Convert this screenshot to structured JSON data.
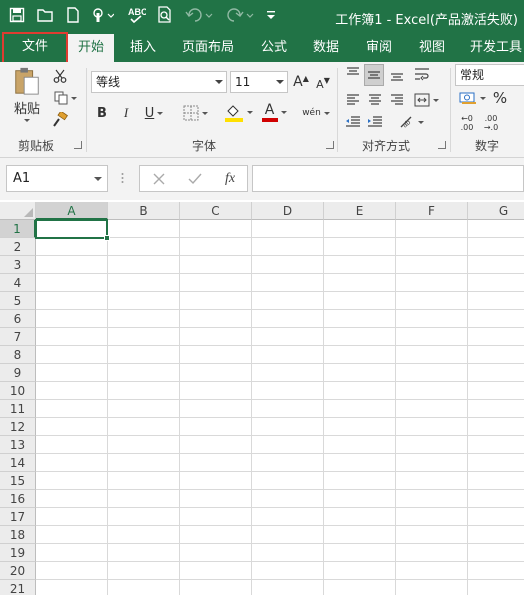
{
  "window": {
    "title": "工作簿1 - Excel(产品激活失败)"
  },
  "quick_access": [
    "save-icon",
    "open-folder-icon",
    "new-file-icon",
    "touch-mode-icon",
    "spelling-icon",
    "print-preview-icon",
    "undo-icon",
    "redo-icon",
    "customize-icon"
  ],
  "tabs": [
    {
      "label": "文件",
      "state": "highlighted"
    },
    {
      "label": "开始",
      "state": "active"
    },
    {
      "label": "插入"
    },
    {
      "label": "页面布局"
    },
    {
      "label": "公式"
    },
    {
      "label": "数据"
    },
    {
      "label": "审阅"
    },
    {
      "label": "视图"
    },
    {
      "label": "开发工具"
    }
  ],
  "ribbon": {
    "clipboard": {
      "label": "剪贴板",
      "paste_label": "粘贴"
    },
    "font": {
      "label": "字体",
      "font_name": "等线",
      "font_size": "11",
      "bold": "B",
      "italic": "I",
      "underline": "U",
      "font_color_glyph": "A",
      "phonetic_glyph": "wén",
      "grow_glyph": "A",
      "shrink_glyph": "A"
    },
    "alignment": {
      "label": "对齐方式"
    },
    "number": {
      "label": "数字",
      "format": "常规",
      "percent": "%"
    }
  },
  "formula_bar": {
    "name_box": "A1",
    "fx_label": "fx",
    "formula": ""
  },
  "sheet": {
    "columns": [
      "A",
      "B",
      "C",
      "D",
      "E",
      "F",
      "G"
    ],
    "rows": [
      "1",
      "2",
      "3",
      "4",
      "5",
      "6",
      "7",
      "8",
      "9",
      "10",
      "11",
      "12",
      "13",
      "14",
      "15",
      "16",
      "17",
      "18",
      "19",
      "20",
      "21"
    ],
    "active_cell": "A1"
  },
  "colors": {
    "brand": "#217346",
    "file_tab_highlight": "#e03c31",
    "font_color_bar": "#d00000",
    "fill_color_bar": "#ffe000"
  }
}
